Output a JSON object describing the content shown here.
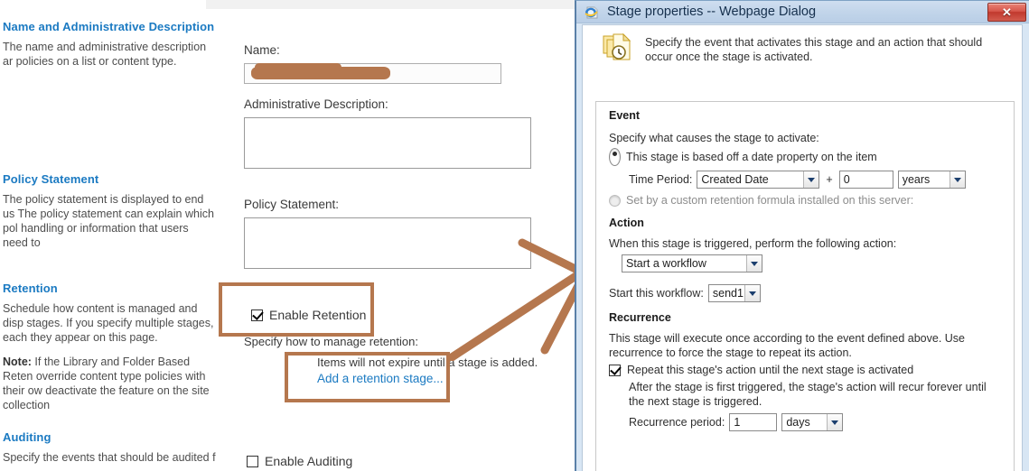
{
  "page": {
    "sections": [
      {
        "id": "name-admin",
        "heading": "Name and Administrative Description",
        "body": "The name and administrative description ar policies on a list or content type."
      },
      {
        "id": "policy-statement",
        "heading": "Policy Statement",
        "body": "The policy statement is displayed to end us The policy statement can explain which pol handling or information that users need to"
      },
      {
        "id": "retention",
        "heading": "Retention",
        "body": "Schedule how content is managed and disp stages. If you specify multiple stages, each they appear on this page.",
        "note_label": "Note:",
        "note": " If the Library and Folder Based Reten override content type policies with their ow deactivate the feature on the site collection"
      },
      {
        "id": "auditing",
        "heading": "Auditing",
        "body": "Specify the events that should be audited f"
      }
    ],
    "form": {
      "name_label": "Name:",
      "name_value": "",
      "admin_desc_label": "Administrative Description:",
      "admin_desc_value": "",
      "policy_statement_label": "Policy Statement:",
      "policy_statement_value": "",
      "enable_retention_label": "Enable Retention",
      "enable_retention_checked": true,
      "specify_retention_label": "Specify how to manage retention:",
      "no_stage_text": "Items will not expire until a stage is added.",
      "add_stage_link": "Add a retention stage...",
      "enable_auditing_label": "Enable Auditing",
      "enable_auditing_checked": false
    }
  },
  "annotations": {
    "color": "#b5774e",
    "boxes": [
      "enable-retention-highlight",
      "add-retention-stage-highlight"
    ],
    "arrow": "arrow-to-dialog"
  },
  "dialog": {
    "icon": "internet-explorer-icon",
    "title": "Stage properties -- Webpage Dialog",
    "close_label": "✕",
    "header_icon": "documents-clock-icon",
    "header_text": "Specify the event that activates this stage and an action that should occur once the stage is activated.",
    "event": {
      "group_title": "Event",
      "prompt": "Specify what causes the stage to activate:",
      "option_date_label": "This stage is based off a date property on the item",
      "option_date_selected": true,
      "time_period_label": "Time Period:",
      "time_period_property": "Created Date",
      "plus_sign": "+",
      "time_period_amount": "0",
      "time_period_unit": "years",
      "option_formula_label": "Set by a custom retention formula installed on this server:",
      "option_formula_selected": false
    },
    "action": {
      "group_title": "Action",
      "prompt": "When this stage is triggered, perform the following action:",
      "action_value": "Start a workflow",
      "workflow_label": "Start this workflow:",
      "workflow_value": "send1"
    },
    "recurrence": {
      "group_title": "Recurrence",
      "description": "This stage will execute once according to the event defined above. Use recurrence to force the stage to repeat its action.",
      "repeat_label": "Repeat this stage's action until the next stage is activated",
      "repeat_checked": true,
      "repeat_detail": "After the stage is first triggered, the stage's action will recur forever until the next stage is triggered.",
      "period_label": "Recurrence period:",
      "period_value": "1",
      "period_unit": "days"
    }
  }
}
